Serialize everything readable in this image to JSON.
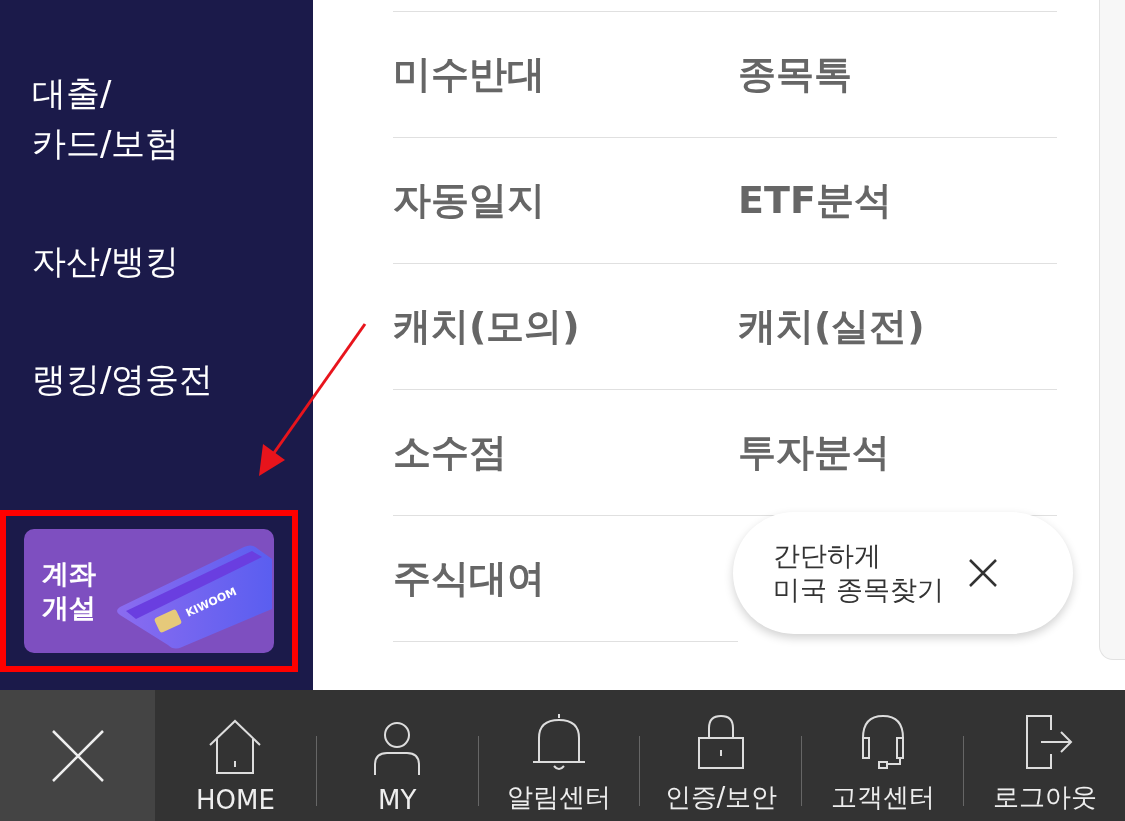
{
  "sidebar": {
    "items": [
      {
        "label": "대출/\n카드/보험"
      },
      {
        "label": "자산/뱅킹"
      },
      {
        "label": "랭킹/영웅전"
      }
    ],
    "banner": {
      "label": "계좌\n개설",
      "card_brand": "KIWOOM"
    }
  },
  "menu": {
    "items": [
      {
        "label": "미수반대"
      },
      {
        "label": "종목톡"
      },
      {
        "label": "자동일지"
      },
      {
        "label": "ETF분석"
      },
      {
        "label": "캐치(모의)"
      },
      {
        "label": "캐치(실전)"
      },
      {
        "label": "소수점"
      },
      {
        "label": "투자분석"
      },
      {
        "label": "주식대여"
      }
    ]
  },
  "popup": {
    "text": "간단하게\n미국 종목찾기"
  },
  "bottom_bar": {
    "items": [
      {
        "kind": "home",
        "label": "HOME"
      },
      {
        "kind": "user",
        "label": "MY"
      },
      {
        "kind": "bell",
        "label": "알림센터"
      },
      {
        "kind": "lock",
        "label": "인증/보안"
      },
      {
        "kind": "headset",
        "label": "고객센터"
      },
      {
        "kind": "logout",
        "label": "로그아웃"
      }
    ]
  }
}
